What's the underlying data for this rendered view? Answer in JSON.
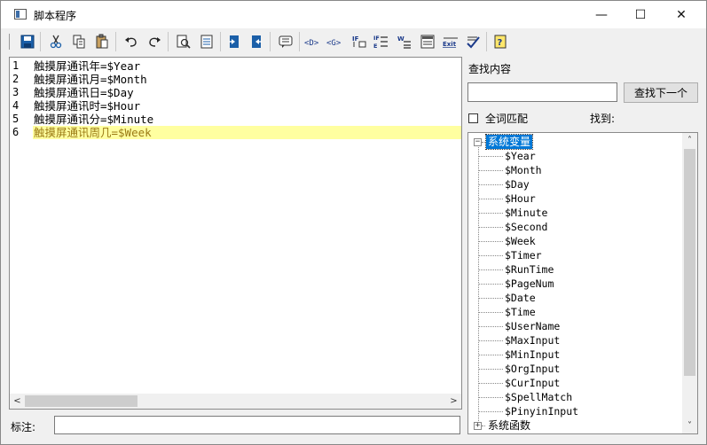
{
  "window": {
    "title": "脚本程序",
    "minimize": "—",
    "maximize": "☐",
    "close": "✕"
  },
  "toolbar": {
    "buttons": [
      {
        "name": "save-icon"
      },
      {
        "name": "cut-icon"
      },
      {
        "name": "copy-icon"
      },
      {
        "name": "paste-icon"
      },
      {
        "name": "undo-icon"
      },
      {
        "name": "redo-icon"
      },
      {
        "name": "preview-icon"
      },
      {
        "name": "document-icon"
      },
      {
        "name": "indent-icon"
      },
      {
        "name": "outdent-icon"
      },
      {
        "name": "comment-icon"
      },
      {
        "name": "d-tag-icon",
        "label": "<D>"
      },
      {
        "name": "g-tag-icon",
        "label": "<G>"
      },
      {
        "name": "if-icon",
        "label": "IF"
      },
      {
        "name": "if-else-icon",
        "label": "IF E"
      },
      {
        "name": "while-icon",
        "label": "W"
      },
      {
        "name": "list-icon"
      },
      {
        "name": "exit-icon",
        "label": "Exit"
      },
      {
        "name": "check-icon"
      },
      {
        "name": "help-icon",
        "label": "?"
      }
    ]
  },
  "editor": {
    "lines": [
      {
        "num": "1",
        "text": "触摸屏通讯年=$Year"
      },
      {
        "num": "2",
        "text": "触摸屏通讯月=$Month"
      },
      {
        "num": "3",
        "text": "触摸屏通讯日=$Day"
      },
      {
        "num": "4",
        "text": "触摸屏通讯时=$Hour"
      },
      {
        "num": "5",
        "text": "触摸屏通讯分=$Minute"
      },
      {
        "num": "6",
        "text": "触摸屏通讯周几=$Week"
      }
    ],
    "current_line_color": "#ffffa0"
  },
  "note": {
    "label": "标注:",
    "value": ""
  },
  "search": {
    "label": "查找内容",
    "value": "",
    "find_next": "查找下一个",
    "whole_word": "全词匹配",
    "found": "找到:"
  },
  "tree": {
    "root1": {
      "expander": "−",
      "label": "系统变量"
    },
    "items": [
      "$Year",
      "$Month",
      "$Day",
      "$Hour",
      "$Minute",
      "$Second",
      "$Week",
      "$Timer",
      "$RunTime",
      "$PageNum",
      "$Date",
      "$Time",
      "$UserName",
      "$MaxInput",
      "$MinInput",
      "$OrgInput",
      "$CurInput",
      "$SpellMatch",
      "$PinyinInput"
    ],
    "root2": {
      "expander": "+",
      "label": "系统函数"
    }
  },
  "colors": {
    "selection": "#0078d7",
    "save_icon": "#1b5fa8"
  }
}
